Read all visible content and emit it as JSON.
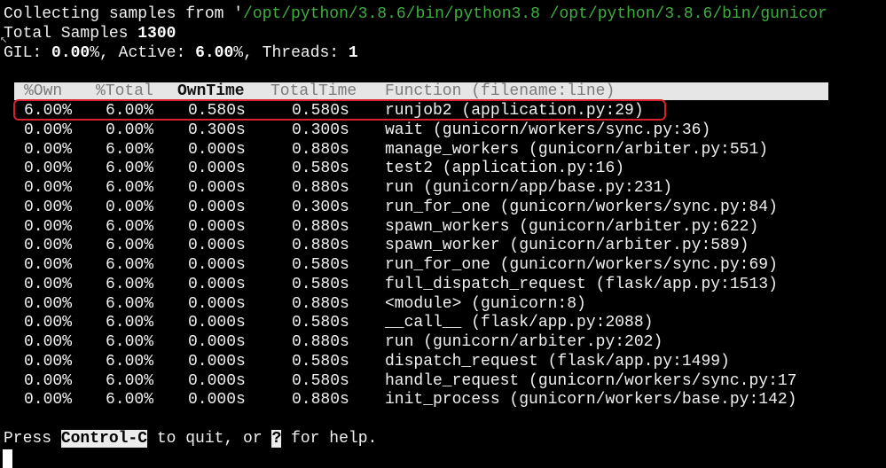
{
  "status": {
    "collecting_prefix": "Collecting samples from '",
    "collecting_path": "/opt/python/3.8.6/bin/python3.8 /opt/python/3.8.6/bin/gunicor",
    "total_label": "Total Samples ",
    "total_value": "1300",
    "gil_label": "GIL: ",
    "gil_value": "0.00",
    "active_label": "%, Active: ",
    "active_value": "6.00",
    "threads_label": "%, Threads: ",
    "threads_value": "1"
  },
  "table": {
    "columns": [
      "%Own",
      "%Total",
      "OwnTime",
      "TotalTime",
      "Function (filename:line)"
    ],
    "sorted_column": "OwnTime",
    "rows": [
      {
        "own": "6.00%",
        "total": "6.00%",
        "owntime": "0.580s",
        "totaltime": "0.580s",
        "function": "runjob2 (application.py:29)"
      },
      {
        "own": "0.00%",
        "total": "0.00%",
        "owntime": "0.300s",
        "totaltime": "0.300s",
        "function": "wait (gunicorn/workers/sync.py:36)"
      },
      {
        "own": "0.00%",
        "total": "6.00%",
        "owntime": "0.000s",
        "totaltime": "0.880s",
        "function": "manage_workers (gunicorn/arbiter.py:551)"
      },
      {
        "own": "0.00%",
        "total": "6.00%",
        "owntime": "0.000s",
        "totaltime": "0.580s",
        "function": "test2 (application.py:16)"
      },
      {
        "own": "0.00%",
        "total": "6.00%",
        "owntime": "0.000s",
        "totaltime": "0.880s",
        "function": "run (gunicorn/app/base.py:231)"
      },
      {
        "own": "0.00%",
        "total": "0.00%",
        "owntime": "0.000s",
        "totaltime": "0.300s",
        "function": "run_for_one (gunicorn/workers/sync.py:84)"
      },
      {
        "own": "0.00%",
        "total": "6.00%",
        "owntime": "0.000s",
        "totaltime": "0.880s",
        "function": "spawn_workers (gunicorn/arbiter.py:622)"
      },
      {
        "own": "0.00%",
        "total": "6.00%",
        "owntime": "0.000s",
        "totaltime": "0.880s",
        "function": "spawn_worker (gunicorn/arbiter.py:589)"
      },
      {
        "own": "0.00%",
        "total": "6.00%",
        "owntime": "0.000s",
        "totaltime": "0.580s",
        "function": "run_for_one (gunicorn/workers/sync.py:69)"
      },
      {
        "own": "0.00%",
        "total": "6.00%",
        "owntime": "0.000s",
        "totaltime": "0.580s",
        "function": "full_dispatch_request (flask/app.py:1513)"
      },
      {
        "own": "0.00%",
        "total": "6.00%",
        "owntime": "0.000s",
        "totaltime": "0.880s",
        "function": "<module> (gunicorn:8)"
      },
      {
        "own": "0.00%",
        "total": "6.00%",
        "owntime": "0.000s",
        "totaltime": "0.580s",
        "function": "__call__ (flask/app.py:2088)"
      },
      {
        "own": "0.00%",
        "total": "6.00%",
        "owntime": "0.000s",
        "totaltime": "0.880s",
        "function": "run (gunicorn/arbiter.py:202)"
      },
      {
        "own": "0.00%",
        "total": "6.00%",
        "owntime": "0.000s",
        "totaltime": "0.580s",
        "function": "dispatch_request (flask/app.py:1499)"
      },
      {
        "own": "0.00%",
        "total": "6.00%",
        "owntime": "0.000s",
        "totaltime": "0.580s",
        "function": "handle_request (gunicorn/workers/sync.py:17"
      },
      {
        "own": "0.00%",
        "total": "6.00%",
        "owntime": "0.000s",
        "totaltime": "0.880s",
        "function": "init_process (gunicorn/workers/base.py:142)"
      }
    ]
  },
  "footer": {
    "press": "Press ",
    "key_quit": "Control-C",
    "to_quit": " to quit, or ",
    "key_help": "?",
    "for_help": " for help."
  },
  "colors": {
    "background": "#000000",
    "text": "#f0f0f0",
    "path": "#3fae3f",
    "header_bar": "#e6e6e6",
    "highlight_border": "#d9202a"
  }
}
